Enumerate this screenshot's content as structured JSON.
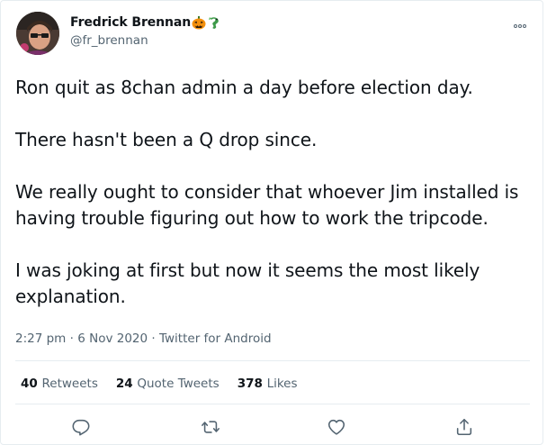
{
  "author": {
    "display_name": "Fredrick Brennan",
    "handle": "@fr_brennan"
  },
  "tweet": {
    "paragraphs": [
      "Ron quit as 8chan admin a day before election day.",
      "There hasn't been a Q drop since.",
      "We really ought to consider that whoever Jim installed is having trouble figuring out how to work the tripcode.",
      "I was joking at first but now it seems the most likely explanation."
    ]
  },
  "meta": {
    "time": "2:27 pm",
    "separator": "·",
    "date": "6 Nov 2020",
    "source": "Twitter for Android"
  },
  "stats": {
    "retweets_count": "40",
    "retweets_label": "Retweets",
    "quotes_count": "24",
    "quotes_label": "Quote Tweets",
    "likes_count": "378",
    "likes_label": "Likes"
  },
  "icons": {
    "name_emoji_1": "pumpkin-icon",
    "name_emoji_2": "dragon-icon",
    "more": "more-icon",
    "reply": "reply-icon",
    "retweet": "retweet-icon",
    "like": "heart-icon",
    "share": "share-icon"
  },
  "colors": {
    "text_primary": "#0f1419",
    "text_secondary": "#536471",
    "divider": "#e6ecf0",
    "pumpkin": "#f4900c",
    "dragon": "#3e9a4a"
  }
}
